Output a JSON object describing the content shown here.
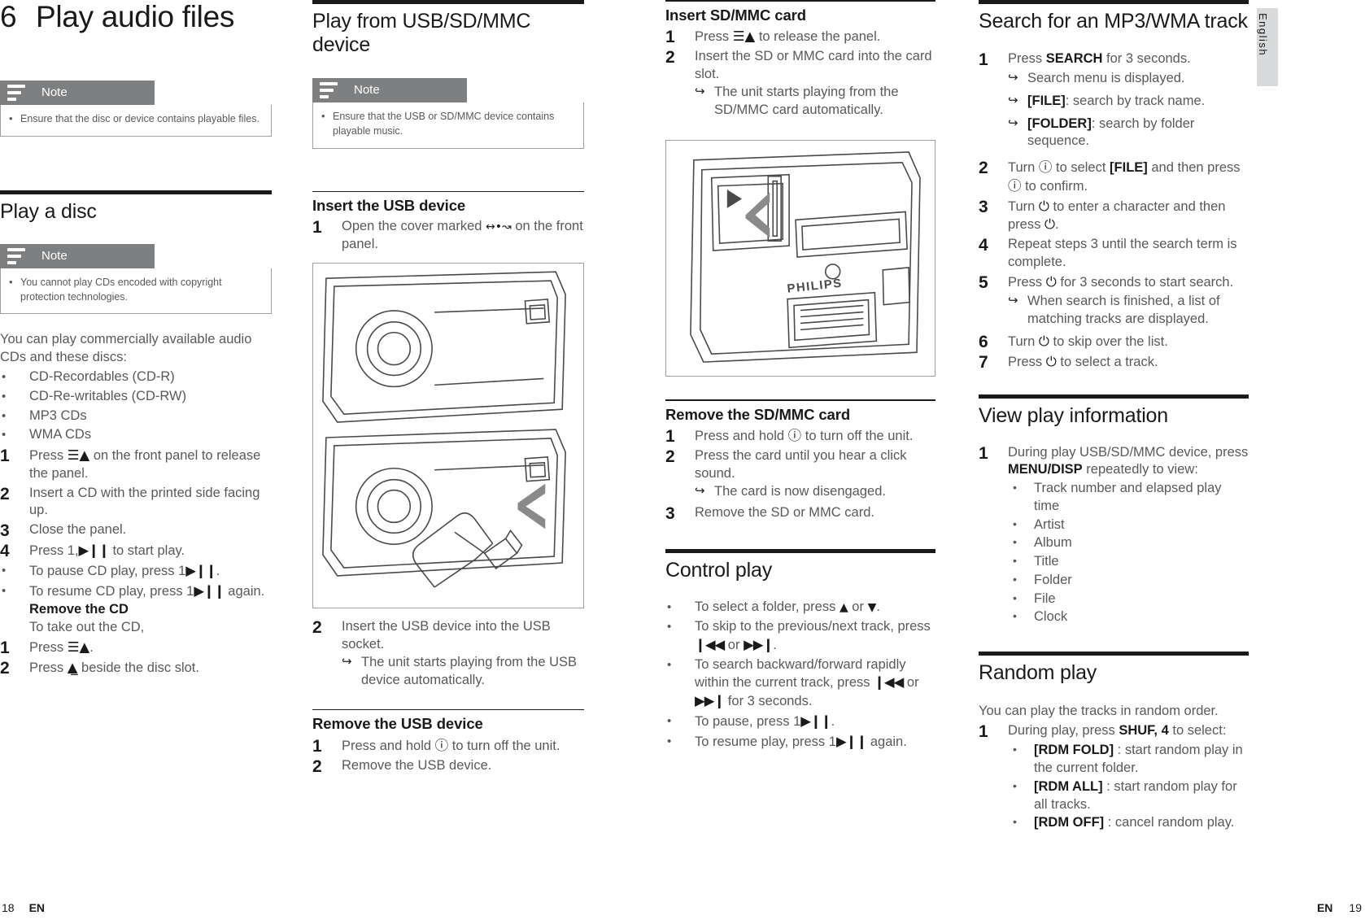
{
  "meta": {
    "language_tab": "English",
    "footer_left_page": "18",
    "footer_left_lang": "EN",
    "footer_right_lang": "EN",
    "footer_right_page": "19"
  },
  "chapter": {
    "number": "6",
    "title": "Play audio files"
  },
  "notes": {
    "label": "Note",
    "intro_note": "Ensure that the disc or device contains playable files.",
    "disc_note": "You cannot play CDs encoded with copyright protection technologies.",
    "usb_note": "Ensure that the USB or SD/MMC device contains playable music."
  },
  "play_a_disc": {
    "heading": "Play a disc",
    "intro": "You can play commercially available audio CDs and these discs:",
    "disc_types": [
      "CD-Recordables (CD-R)",
      "CD-Re-writables (CD-RW)",
      "MP3 CDs",
      "WMA CDs"
    ],
    "steps": [
      {
        "num": "1",
        "text_before": "Press ",
        "glyph": "eject-panel-icon",
        "text_after": " on the front panel to release the panel."
      },
      {
        "num": "2",
        "text": "Insert a CD with the printed side facing up."
      },
      {
        "num": "3",
        "text": "Close the panel."
      },
      {
        "num": "4",
        "text_before": "Press 1,",
        "glyph": "play-pause-icon",
        "text_after": " to start play."
      }
    ],
    "bullets": [
      {
        "text_before": "To pause CD play, press 1",
        "glyph": "play-pause-icon",
        "text_after": "."
      },
      {
        "text_before": "To resume CD play, press 1",
        "glyph": "play-pause-icon",
        "text_after": " again."
      }
    ],
    "remove_heading": "Remove the CD",
    "remove_intro": "To take out the CD,",
    "remove_steps": [
      {
        "num": "1",
        "text_before": "Press ",
        "glyph": "eject-panel-icon",
        "text_after": "."
      },
      {
        "num": "2",
        "text_before": "Press ",
        "glyph": "eject-disc-icon",
        "text_after": " beside the disc slot."
      }
    ]
  },
  "play_from_usb": {
    "heading": "Play from USB/SD/MMC device",
    "insert_usb_heading": "Insert the USB device",
    "insert_usb_step1": {
      "num": "1",
      "text_before": "Open the cover marked ",
      "glyph": "usb-icon",
      "text_after": " on the front panel."
    },
    "insert_usb_step2": {
      "num": "2",
      "text": "Insert the USB device into the USB socket."
    },
    "insert_usb_result": "The unit starts playing from the USB device automatically.",
    "remove_usb_heading": "Remove the USB device",
    "remove_usb_steps": [
      {
        "num": "1",
        "text_before": "Press and hold ",
        "glyph": "power-icon",
        "text_after": " to turn off the unit."
      },
      {
        "num": "2",
        "text": "Remove the USB device."
      }
    ],
    "figure_name": "usb-insertion-illustration"
  },
  "insert_sd": {
    "heading": "Insert SD/MMC card",
    "steps": [
      {
        "num": "1",
        "text_before": "Press ",
        "glyph": "eject-panel-icon",
        "text_after": " to release the panel."
      },
      {
        "num": "2",
        "text": "Insert the SD or MMC card into the card slot."
      }
    ],
    "result": "The unit starts playing from the SD/MMC card automatically.",
    "figure_name": "sd-card-slot-illustration",
    "figure_brand": "PHILIPS"
  },
  "remove_sd": {
    "heading": "Remove the SD/MMC card",
    "steps": [
      {
        "num": "1",
        "text_before": "Press and hold ",
        "glyph": "power-icon",
        "text_after": " to turn off the unit."
      },
      {
        "num": "2",
        "text": "Press the card until you hear a click sound."
      },
      {
        "num": "3",
        "text": "Remove the SD or MMC card."
      }
    ],
    "result": "The card is now disengaged."
  },
  "control_play": {
    "heading": "Control play",
    "bullets": [
      {
        "parts": [
          "To select a folder, press ",
          "up-arrow-icon",
          " or ",
          "down-arrow-icon",
          "."
        ]
      },
      {
        "parts": [
          "To skip to the previous/next track, press ",
          "prev-track-icon",
          " or ",
          "next-track-icon",
          "."
        ]
      },
      {
        "parts": [
          "To search backward/forward rapidly within the current track, press ",
          "prev-track-icon",
          " or ",
          "next-track-icon",
          " for 3 seconds."
        ]
      },
      {
        "parts": [
          "To pause, press 1",
          "play-pause-icon",
          "."
        ]
      },
      {
        "parts": [
          "To resume play, press 1",
          "play-pause-icon",
          " again."
        ]
      }
    ]
  },
  "search_track": {
    "heading": "Search for an MP3/WMA track",
    "step1": {
      "num": "1",
      "text_before": "Press ",
      "bold": "SEARCH",
      "text_after": " for 3 seconds."
    },
    "step1_results": [
      {
        "plain": "Search menu is displayed."
      },
      {
        "bold": "[FILE]",
        "plain": ": search by track name."
      },
      {
        "bold": "[FOLDER]",
        "plain": ": search by folder sequence."
      }
    ],
    "step2": {
      "num": "2",
      "a": "Turn ",
      "g1": "power-icon",
      "b": " to select ",
      "bold": "[FILE]",
      "c": "  and then press ",
      "g2": "power-icon",
      "d": " to confirm."
    },
    "step3": {
      "num": "3",
      "a": "Turn ",
      "g1": "power-icon",
      "b": " to enter a character and then press ",
      "g2": "power-icon",
      "c": "."
    },
    "step4": {
      "num": "4",
      "text": "Repeat steps 3 until the search term is complete."
    },
    "step5": {
      "num": "5",
      "a": "Press ",
      "g1": "power-icon",
      "b": " for 3 seconds to start search."
    },
    "step5_result": "When search is finished, a list of matching tracks are displayed.",
    "step6": {
      "num": "6",
      "a": "Turn ",
      "g1": "power-icon",
      "b": " to skip over the list."
    },
    "step7": {
      "num": "7",
      "a": "Press ",
      "g1": "power-icon",
      "b": " to select a track."
    }
  },
  "view_play_info": {
    "heading": "View play information",
    "step1": {
      "num": "1",
      "a": "During play USB/SD/MMC device, press ",
      "bold": "MENU/DISP",
      "b": " repeatedly to view:"
    },
    "items": [
      "Track number and elapsed play time",
      "Artist",
      "Album",
      "Title",
      "Folder",
      "File",
      "Clock"
    ]
  },
  "random_play": {
    "heading": "Random play",
    "intro": "You can play the tracks in random order.",
    "step1": {
      "num": "1",
      "a": "During play, press ",
      "bold": "SHUF, 4",
      "b": " to select:"
    },
    "options": [
      {
        "bold": "[RDM FOLD]",
        "plain": " : start random play in the current folder."
      },
      {
        "bold": "[RDM ALL]",
        "plain": " : start random play for all tracks."
      },
      {
        "bold": "[RDM OFF]",
        "plain": " : cancel random play."
      }
    ]
  },
  "colors": {
    "heading_dark": "#1a1a1a",
    "body_gray": "#58595b",
    "note_tab_gray": "#7d7f81",
    "side_tab_gray": "#d9dadb",
    "border_gray": "#9d9fa2"
  }
}
